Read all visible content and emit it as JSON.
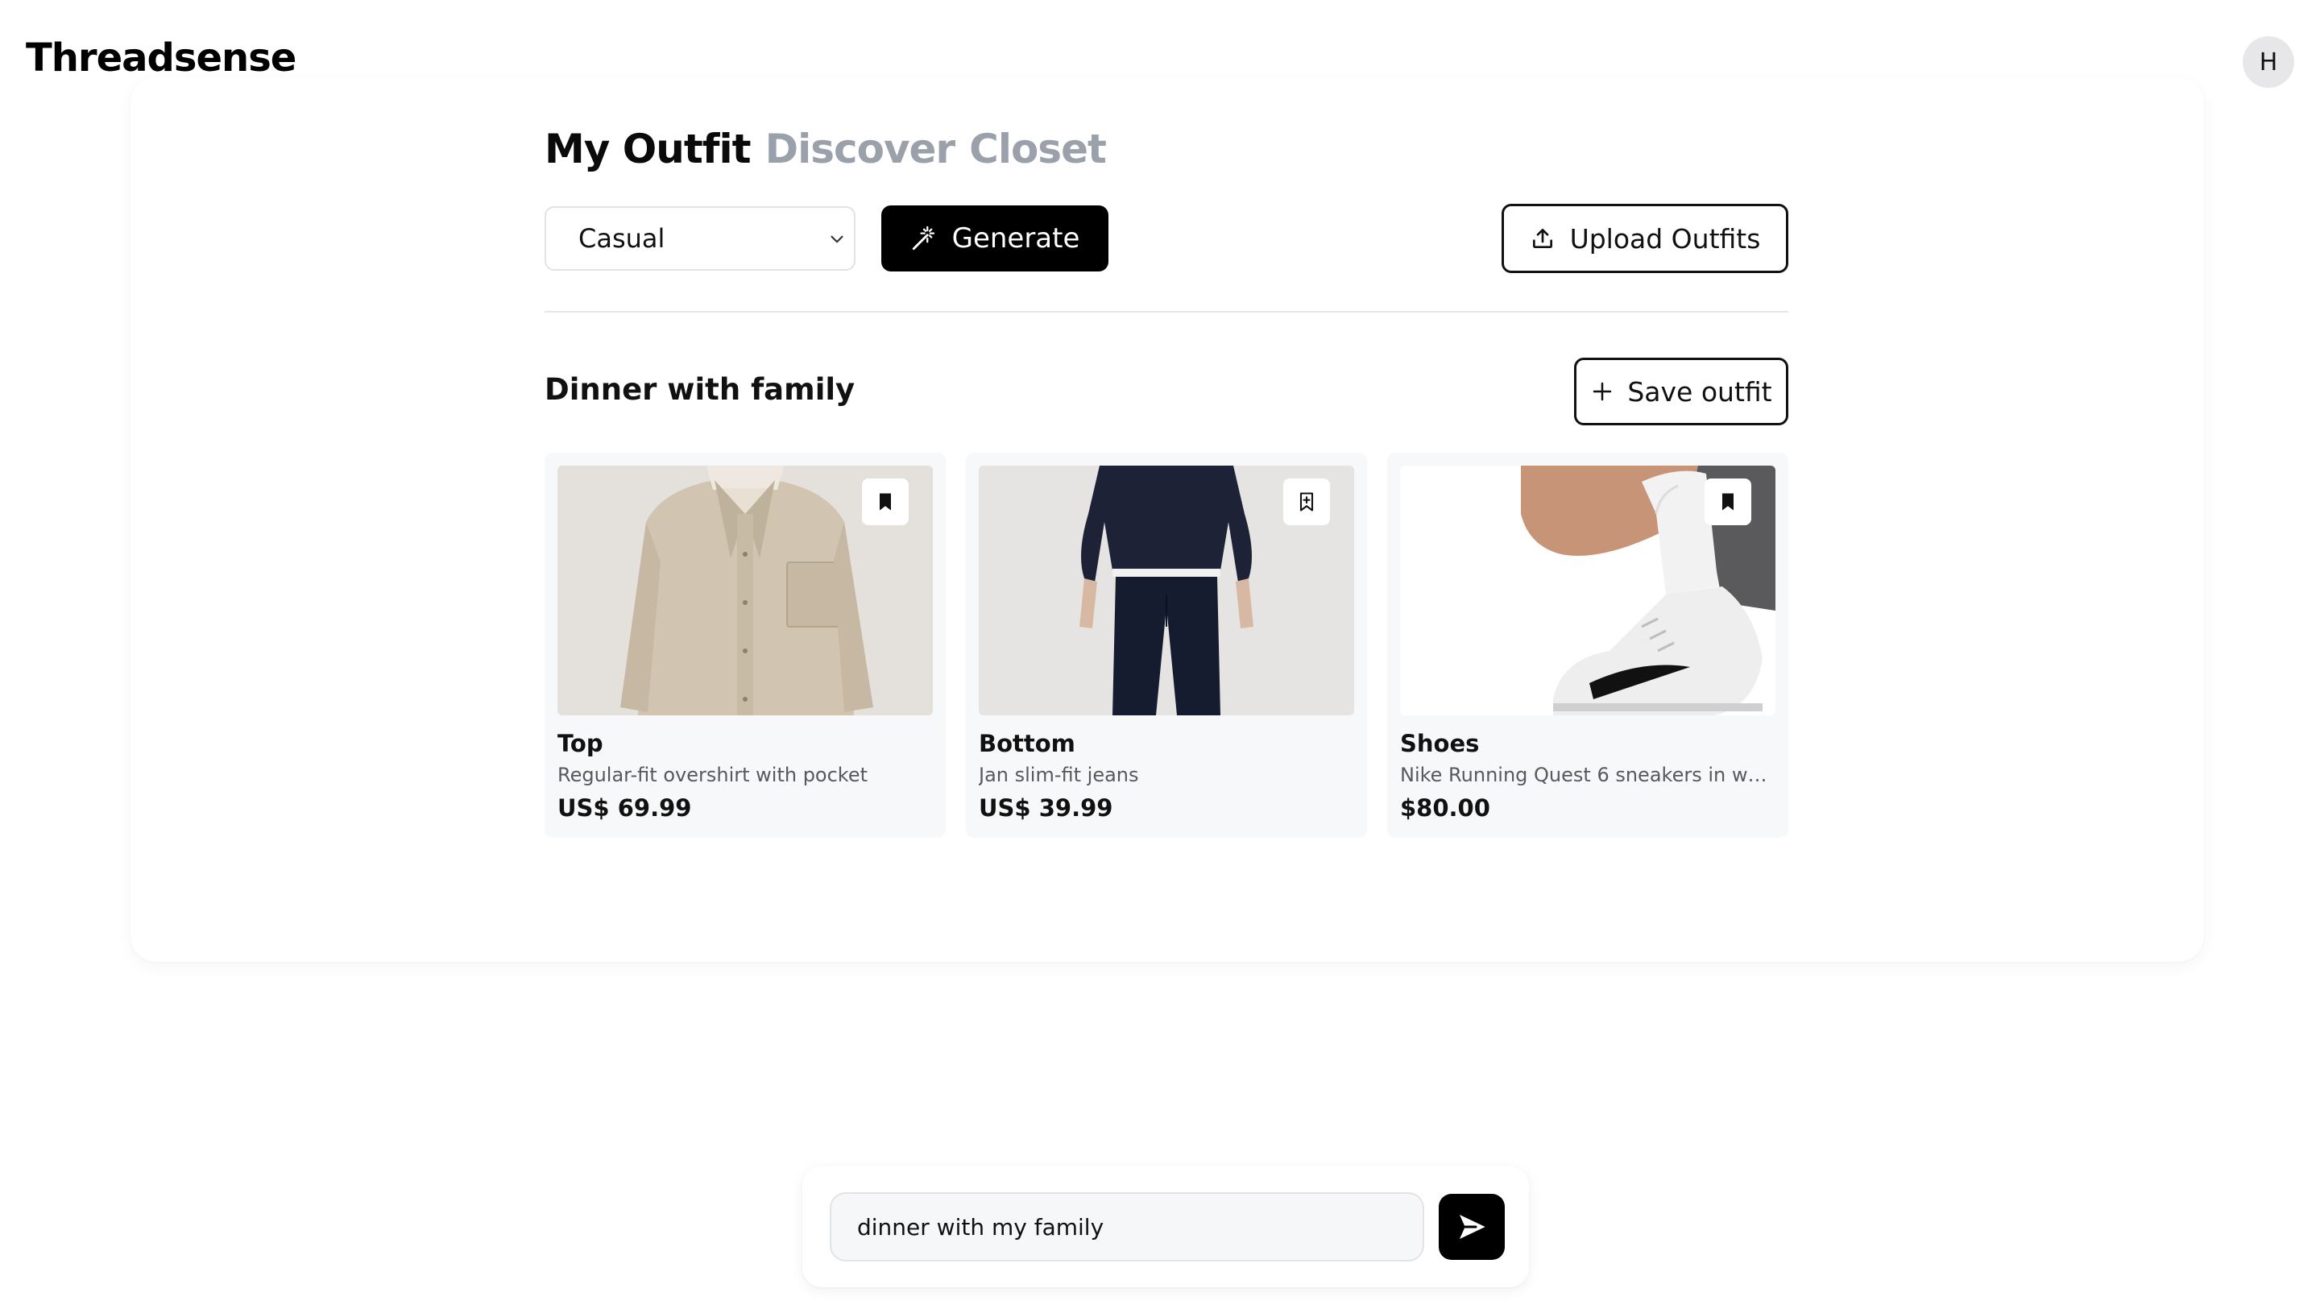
{
  "app": {
    "brand": "Threadsense",
    "avatar_initial": "H"
  },
  "tabs": [
    {
      "label": "My Outfit",
      "active": true
    },
    {
      "label": "Discover",
      "active": false
    },
    {
      "label": "Closet",
      "active": false
    }
  ],
  "toolbar": {
    "style_selected": "Casual",
    "generate_label": "Generate",
    "upload_label": "Upload Outfits"
  },
  "outfit": {
    "title": "Dinner with family",
    "save_label": "Save outfit",
    "items": [
      {
        "category": "Top",
        "description": "Regular-fit overshirt with pocket",
        "price": "US$ 69.99",
        "icon": "bookmark-filled-icon"
      },
      {
        "category": "Bottom",
        "description": "Jan slim-fit jeans",
        "price": "US$ 39.99",
        "icon": "bookmark-plus-icon"
      },
      {
        "category": "Shoes",
        "description": "Nike Running Quest 6 sneakers in white an...",
        "price": "$80.00",
        "icon": "bookmark-filled-icon"
      }
    ]
  },
  "chat": {
    "input_value": "dinner with my family"
  },
  "colors": {
    "accent": "#000000",
    "muted_tab": "#9aa1aa",
    "card_bg": "#f7f8f9"
  }
}
